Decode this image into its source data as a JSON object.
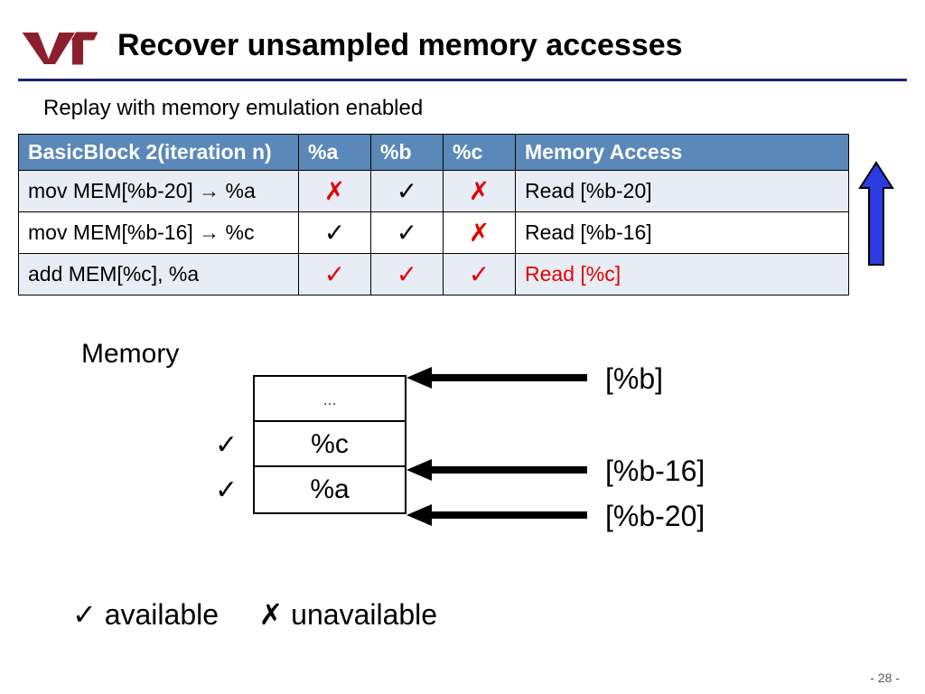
{
  "title": "Recover unsampled memory accesses",
  "subtitle": "Replay with memory emulation enabled",
  "headers": [
    "BasicBlock 2(iteration n)",
    "%a",
    "%b",
    "%c",
    "Memory Access"
  ],
  "rows": [
    {
      "instr": "mov MEM[%b-20] → %a",
      "a": "✗",
      "b": "✓",
      "c": "✗",
      "mem": "Read [%b-20]",
      "mem_red": false
    },
    {
      "instr": "mov MEM[%b-16] → %c",
      "a": "✓",
      "b": "✓",
      "c": "✗",
      "mem": "Read [%b-16]",
      "mem_red": false
    },
    {
      "instr": "add MEM[%c], %a",
      "a": "✓",
      "b": "✓",
      "c": "✓",
      "mem": "Read [%c]",
      "mem_red": true
    }
  ],
  "memory_label": "Memory",
  "stack": {
    "dots": "...",
    "cell1": "%c",
    "cell2": "%a"
  },
  "pointers": {
    "top": "[%b]",
    "mid": "[%b-16]",
    "bot": "[%b-20]"
  },
  "check": "✓",
  "cross": "✗",
  "legend_available": "available",
  "legend_unavailable": "unavailable",
  "page": "- 28 -"
}
